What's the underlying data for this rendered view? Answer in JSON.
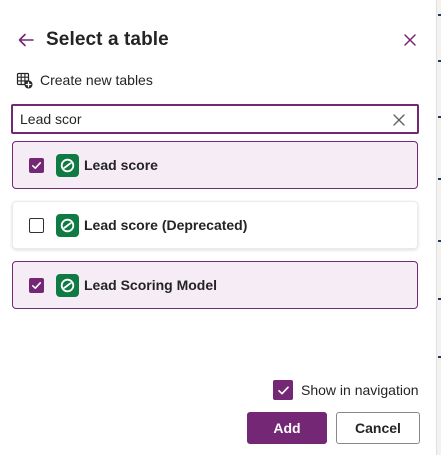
{
  "panel": {
    "title": "Select a table",
    "back_icon": "arrow-left-icon",
    "close_icon": "close-icon"
  },
  "create": {
    "label": "Create new tables",
    "icon": "table-add-icon"
  },
  "search": {
    "value": "Lead scor",
    "clear_icon": "dismiss-icon"
  },
  "tables": [
    {
      "name": "Lead score",
      "checked": true,
      "icon": "dataverse-icon"
    },
    {
      "name": "Lead score (Deprecated)",
      "checked": false,
      "icon": "dataverse-icon"
    },
    {
      "name": "Lead Scoring Model",
      "checked": true,
      "icon": "dataverse-icon"
    }
  ],
  "navigation": {
    "label": "Show in navigation",
    "checked": true
  },
  "footer": {
    "add_label": "Add",
    "cancel_label": "Cancel"
  },
  "colors": {
    "accent": "#742774",
    "accent_light": "#f5ecf5",
    "dataverse_green": "#0f7b43"
  }
}
